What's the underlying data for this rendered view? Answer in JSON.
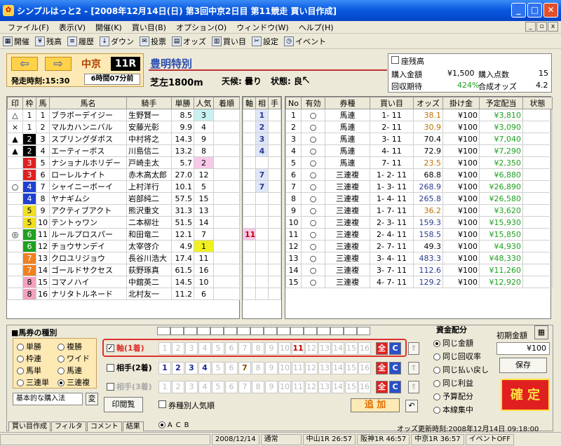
{
  "window": {
    "title": "シンプルはっと2 - [2008年12月14日(日)  第3回中京2日目  第11競走 買い目作成]"
  },
  "menu": [
    "ファイル(F)",
    "表示(V)",
    "開催(K)",
    "買い目(B)",
    "オプション(O)",
    "ウィンドウ(W)",
    "ヘルプ(H)"
  ],
  "toolbar": [
    "開催",
    "残高",
    "履歴",
    "ダウン",
    "投票",
    "オッズ",
    "買い目",
    "設定",
    "イベント"
  ],
  "race": {
    "venue": "中京",
    "number": "11R",
    "start": "発走時刻:15:30",
    "remain": "6時間07分前",
    "name": "豊明特別",
    "course": "芝左1800m",
    "weather": "天候: 曇り",
    "condition": "状態: 良"
  },
  "summary": {
    "zanko": "座残高",
    "buy_amount_label": "購入金額",
    "buy_amount": "¥1,500",
    "buy_count_label": "購入点数",
    "buy_count": "15",
    "recovery_label": "回収期待",
    "recovery": "424%",
    "odds_label": "合成オッズ",
    "odds": "4.2"
  },
  "horse_headers": [
    "印",
    "枠",
    "馬",
    "馬名",
    "騎手",
    "単勝",
    "人気",
    "着順"
  ],
  "horses": [
    {
      "mark": "△",
      "frame": "1",
      "num": "1",
      "name": "ブラボーデイジー",
      "jockey": "生野賢一",
      "odds": "8.5",
      "pop": "3",
      "fc": "#fff",
      "ft": "#000",
      "pc": "#c8f0f0"
    },
    {
      "mark": "×",
      "frame": "1",
      "num": "2",
      "name": "マルカハンニバル",
      "jockey": "安藤光彰",
      "odds": "9.9",
      "pop": "4",
      "fc": "#fff",
      "ft": "#000",
      "pc": ""
    },
    {
      "mark": "▲",
      "frame": "2",
      "num": "3",
      "name": "スプリングダボス",
      "jockey": "中村将之",
      "odds": "14.3",
      "pop": "9",
      "fc": "#000",
      "ft": "#fff",
      "pc": ""
    },
    {
      "mark": "▲",
      "frame": "2",
      "num": "4",
      "name": "エーティーボス",
      "jockey": "川島信二",
      "odds": "13.2",
      "pop": "8",
      "fc": "#000",
      "ft": "#fff",
      "pc": ""
    },
    {
      "mark": "",
      "frame": "3",
      "num": "5",
      "name": "ナショナルホリデー",
      "jockey": "戸崎圭太",
      "odds": "5.7",
      "pop": "2",
      "fc": "#e02020",
      "ft": "#fff",
      "pc": "#f7c8e8"
    },
    {
      "mark": "",
      "frame": "3",
      "num": "6",
      "name": "ローレルナイト",
      "jockey": "赤木高太郎",
      "odds": "27.0",
      "pop": "12",
      "fc": "#e02020",
      "ft": "#fff",
      "pc": ""
    },
    {
      "mark": "○",
      "frame": "4",
      "num": "7",
      "name": "シャイニーボーイ",
      "jockey": "上村洋行",
      "odds": "10.1",
      "pop": "5",
      "fc": "#2040d0",
      "ft": "#fff",
      "pc": ""
    },
    {
      "mark": "",
      "frame": "4",
      "num": "8",
      "name": "ヤナギムシ",
      "jockey": "岩部純二",
      "odds": "57.5",
      "pop": "15",
      "fc": "#2040d0",
      "ft": "#fff",
      "pc": ""
    },
    {
      "mark": "",
      "frame": "5",
      "num": "9",
      "name": "アクティブアクト",
      "jockey": "熊沢重文",
      "odds": "31.3",
      "pop": "13",
      "fc": "#f0e020",
      "ft": "#000",
      "pc": ""
    },
    {
      "mark": "",
      "frame": "5",
      "num": "10",
      "name": "テントゥワン",
      "jockey": "二本柳壮",
      "odds": "51.5",
      "pop": "14",
      "fc": "#f0e020",
      "ft": "#000",
      "pc": ""
    },
    {
      "mark": "◎",
      "frame": "6",
      "num": "11",
      "name": "ルールプロスパー",
      "jockey": "和田竜二",
      "odds": "12.1",
      "pop": "7",
      "fc": "#20a020",
      "ft": "#fff",
      "pc": ""
    },
    {
      "mark": "",
      "frame": "6",
      "num": "12",
      "name": "チョウサンデイ",
      "jockey": "太宰啓介",
      "odds": "4.9",
      "pop": "1",
      "fc": "#20a020",
      "ft": "#fff",
      "pc": "#f0f020"
    },
    {
      "mark": "",
      "frame": "7",
      "num": "13",
      "name": "クロユリジョウ",
      "jockey": "長谷川浩大",
      "odds": "17.4",
      "pop": "11",
      "fc": "#f08020",
      "ft": "#fff",
      "pc": ""
    },
    {
      "mark": "",
      "frame": "7",
      "num": "14",
      "name": "ゴールドサクセス",
      "jockey": "荻野琢真",
      "odds": "61.5",
      "pop": "16",
      "fc": "#f08020",
      "ft": "#fff",
      "pc": ""
    },
    {
      "mark": "",
      "frame": "8",
      "num": "15",
      "name": "コマノハイ",
      "jockey": "中舘英二",
      "odds": "14.5",
      "pop": "10",
      "fc": "#f5a0c0",
      "ft": "#000",
      "pc": ""
    },
    {
      "mark": "",
      "frame": "8",
      "num": "16",
      "name": "ナリタトルネード",
      "jockey": "北村友一",
      "odds": "11.2",
      "pop": "6",
      "fc": "#f5a0c0",
      "ft": "#000",
      "pc": ""
    }
  ],
  "axis_headers": [
    "軸",
    "相",
    "手"
  ],
  "axis_rows": [
    [
      "",
      "1",
      ""
    ],
    [
      "",
      "2",
      ""
    ],
    [
      "",
      "3",
      ""
    ],
    [
      "",
      "4",
      ""
    ],
    [
      "",
      "",
      ""
    ],
    [
      "",
      "7",
      ""
    ],
    [
      "",
      "7",
      ""
    ],
    [
      "",
      "",
      ""
    ],
    [
      "",
      "",
      ""
    ],
    [
      "",
      "",
      ""
    ],
    [
      "11",
      "",
      ""
    ],
    [
      "",
      "",
      ""
    ],
    [
      "",
      "",
      ""
    ],
    [
      "",
      "",
      ""
    ],
    [
      "",
      "",
      ""
    ],
    [
      "",
      "",
      ""
    ]
  ],
  "bet_headers": [
    "No",
    "有効",
    "券種",
    "買い目",
    "オッズ",
    "掛け金",
    "予定配当",
    "状態"
  ],
  "bets": [
    {
      "no": "1",
      "valid": "○",
      "type": "馬連",
      "combo": "1- 11",
      "odds": "38.1",
      "stake": "¥100",
      "pay": "¥3,810"
    },
    {
      "no": "2",
      "valid": "○",
      "type": "馬連",
      "combo": "2- 11",
      "odds": "30.9",
      "stake": "¥100",
      "pay": "¥3,090"
    },
    {
      "no": "3",
      "valid": "○",
      "type": "馬連",
      "combo": "3- 11",
      "odds": "70.4",
      "stake": "¥100",
      "pay": "¥7,040"
    },
    {
      "no": "4",
      "valid": "○",
      "type": "馬連",
      "combo": "4- 11",
      "odds": "72.9",
      "stake": "¥100",
      "pay": "¥7,290"
    },
    {
      "no": "5",
      "valid": "○",
      "type": "馬連",
      "combo": "7- 11",
      "odds": "23.5",
      "stake": "¥100",
      "pay": "¥2,350"
    },
    {
      "no": "6",
      "valid": "○",
      "type": "三連複",
      "combo": "1- 2- 11",
      "odds": "68.8",
      "stake": "¥100",
      "pay": "¥6,880"
    },
    {
      "no": "7",
      "valid": "○",
      "type": "三連複",
      "combo": "1- 3- 11",
      "odds": "268.9",
      "stake": "¥100",
      "pay": "¥26,890"
    },
    {
      "no": "8",
      "valid": "○",
      "type": "三連複",
      "combo": "1- 4- 11",
      "odds": "265.8",
      "stake": "¥100",
      "pay": "¥26,580"
    },
    {
      "no": "9",
      "valid": "○",
      "type": "三連複",
      "combo": "1- 7- 11",
      "odds": "36.2",
      "stake": "¥100",
      "pay": "¥3,620"
    },
    {
      "no": "10",
      "valid": "○",
      "type": "三連複",
      "combo": "2- 3- 11",
      "odds": "159.3",
      "stake": "¥100",
      "pay": "¥15,930"
    },
    {
      "no": "11",
      "valid": "○",
      "type": "三連複",
      "combo": "2- 4- 11",
      "odds": "158.5",
      "stake": "¥100",
      "pay": "¥15,850"
    },
    {
      "no": "12",
      "valid": "○",
      "type": "三連複",
      "combo": "2- 7- 11",
      "odds": "49.3",
      "stake": "¥100",
      "pay": "¥4,930"
    },
    {
      "no": "13",
      "valid": "○",
      "type": "三連複",
      "combo": "3- 4- 11",
      "odds": "483.3",
      "stake": "¥100",
      "pay": "¥48,330"
    },
    {
      "no": "14",
      "valid": "○",
      "type": "三連複",
      "combo": "3- 7- 11",
      "odds": "112.6",
      "stake": "¥100",
      "pay": "¥11,260"
    },
    {
      "no": "15",
      "valid": "○",
      "type": "三連複",
      "combo": "4- 7- 11",
      "odds": "129.2",
      "stake": "¥100",
      "pay": "¥12,920"
    }
  ],
  "bettype_section": "■馬券の種別",
  "bettypes_left": [
    "単勝",
    "枠連",
    "馬単",
    "三連単"
  ],
  "bettypes_right": [
    "複勝",
    "ワイド",
    "馬連",
    "三連複"
  ],
  "basic_label": "基本的な購入法",
  "henko": "変",
  "print": "印閲覧",
  "jiku_label": "軸(1着)",
  "aite_label": "相手(2着)",
  "aite3_label": "相手(3着)",
  "all_btn": "全",
  "clear_btn": "C",
  "popularity_label": "券種別人気順",
  "add_btn": "追 加",
  "shikin_title": "資金配分",
  "shikin": [
    "同じ金額",
    "同じ回収率",
    "同じ払い戻し",
    "同じ利益",
    "予算配分",
    "本線集中"
  ],
  "initial_label": "初期金額",
  "initial_value": "¥100",
  "save_btn": "保存",
  "confirm_btn": "確 定",
  "tabs": [
    "買い目作成",
    "フィルタ",
    "コメント",
    "結果"
  ],
  "tab_radio": [
    "A",
    "C",
    "B"
  ],
  "odds_updated": "オッズ更新時刻:2008年12月14日 09:18:00",
  "status": [
    "2008/12/14",
    "通常",
    "中山1R 26:57",
    "阪神1R 46:57",
    "中京1R 36:57",
    "イベントOFF"
  ]
}
